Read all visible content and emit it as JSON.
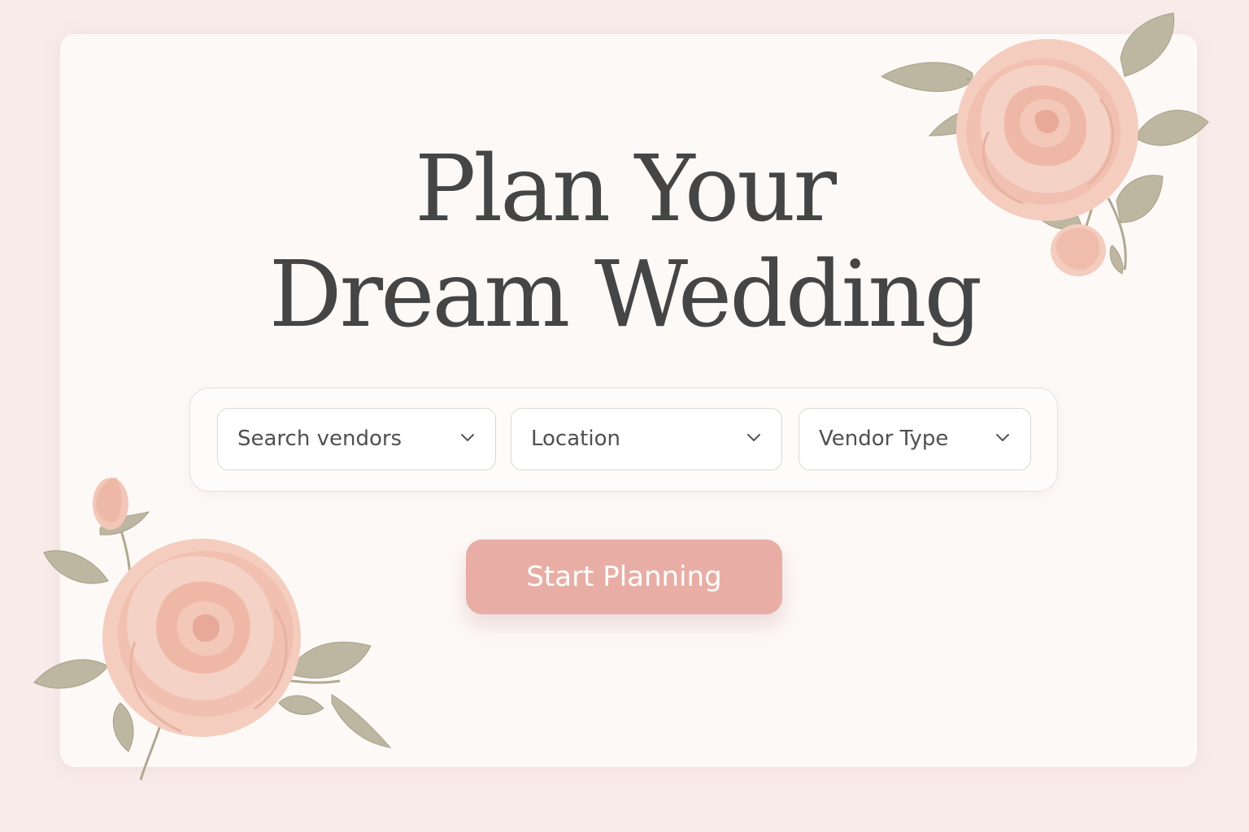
{
  "hero": {
    "title_line1": "Plan Your",
    "title_line2": "Dream Wedding"
  },
  "search": {
    "fields": [
      {
        "label": "Search vendors",
        "icon": "chevron-down-icon"
      },
      {
        "label": "Location",
        "icon": "chevron-down-icon"
      },
      {
        "label": "Vendor Type",
        "icon": "chevron-down-icon"
      }
    ]
  },
  "cta": {
    "label": "Start Planning"
  },
  "decorations": {
    "top_right": "rose-illustration",
    "bottom_left": "rose-illustration"
  },
  "colors": {
    "background": "#f8ebea",
    "card": "#fdf9f7",
    "title": "#454545",
    "button": "#e8aea5",
    "rose": "#f2c2b4",
    "leaf": "#b7b199"
  }
}
